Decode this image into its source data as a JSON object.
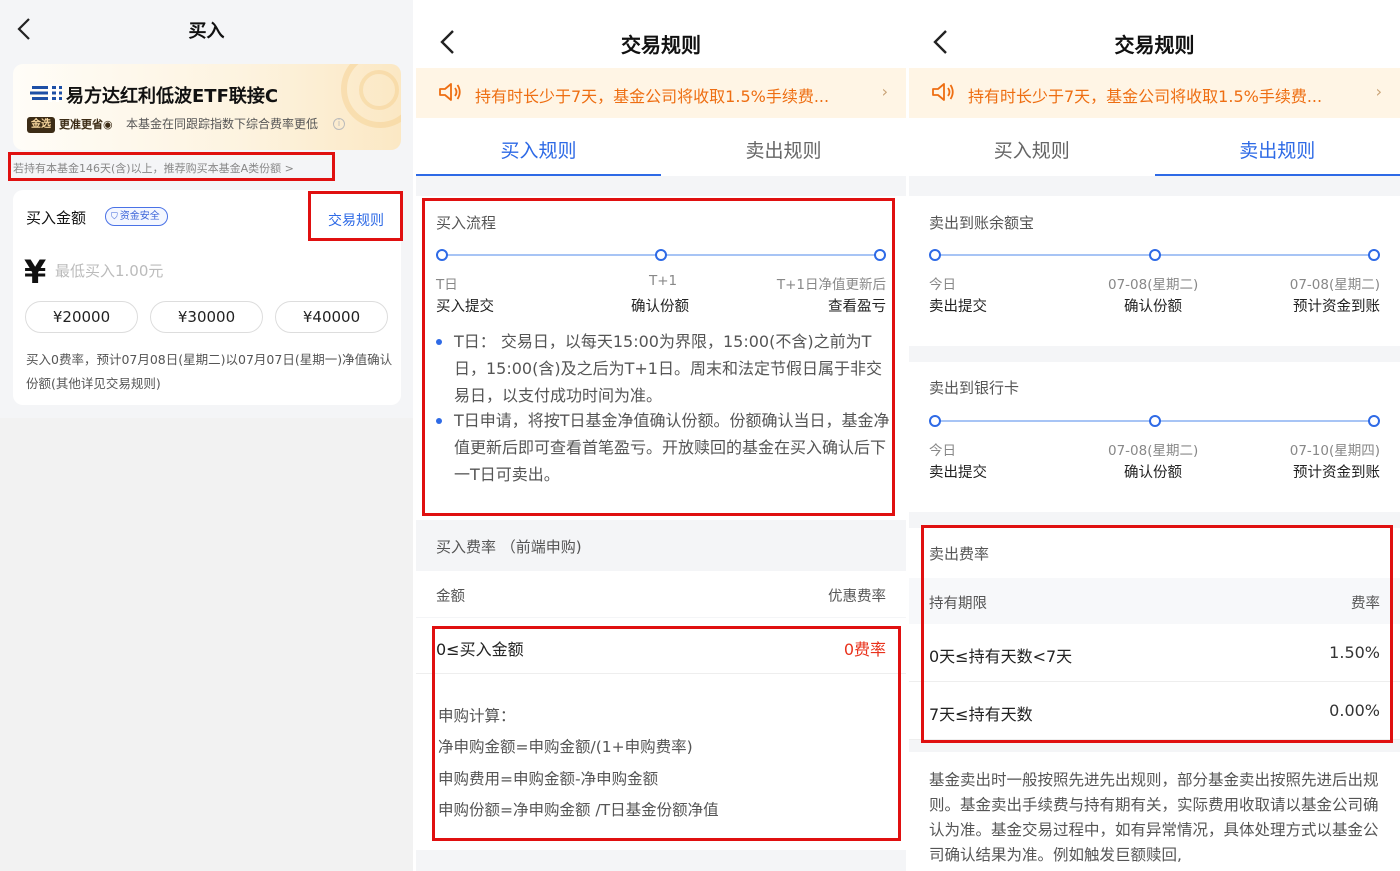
{
  "buy_page": {
    "title": "买入",
    "fund_name": "易方达红利低波ETF联接C",
    "badge_gold": "金选",
    "badge_text": "更准更省",
    "fund_note": "本基金在同跟踪指数下综合费率更低",
    "hold_tip": "若持有本基金146天(含)以上，推荐购买本基金A类份额",
    "amount_label": "买入金额",
    "safe_badge": "资金安全",
    "rule_link": "交易规则",
    "currency": "¥",
    "amount_placeholder": "最低买入1.00元",
    "quick_amounts": [
      "¥20000",
      "¥30000",
      "¥40000"
    ],
    "confirm_desc": "买入0费率，预计07月08日(星期二)以07月07日(星期一)净值确认份额(其他详见交易规则)"
  },
  "buy_rules": {
    "title": "交易规则",
    "notice": "持有时长少于7天，基金公司将收取1.5%手续费...",
    "tabs": [
      {
        "label": "买入规则"
      },
      {
        "label": "卖出规则"
      }
    ],
    "process": {
      "title": "买入流程",
      "steps": [
        {
          "day": "T日",
          "label": "买入提交"
        },
        {
          "day": "T+1",
          "label": "确认份额"
        },
        {
          "day": "T+1日净值更新后",
          "label": "查看盈亏"
        }
      ],
      "bullets": [
        "T日： 交易日，以每天15:00为界限，15:00(不含)之前为T日，15:00(含)及之后为T+1日。周末和法定节假日属于非交易日，以支付成功时间为准。",
        "T日申请，将按T日基金净值确认份额。份额确认当日，基金净值更新后即可查看首笔盈亏。开放赎回的基金在买入确认后下一T日可卖出。"
      ]
    },
    "fee": {
      "title": "买入费率 （前端申购)",
      "col_left": "金额",
      "col_right": "优惠费率",
      "row_left": "0≤买入金额",
      "row_right": "0费率",
      "calc_title": "申购计算：",
      "calc_lines": [
        "净申购金额=申购金额/(1+申购费率)",
        "申购费用=申购金额-净申购金额",
        "申购份额=净申购金额 /T日基金份额净值"
      ]
    }
  },
  "sell_rules": {
    "title": "交易规则",
    "notice": "持有时长少于7天，基金公司将收取1.5%手续费...",
    "tabs": [
      {
        "label": "买入规则"
      },
      {
        "label": "卖出规则"
      }
    ],
    "to_yuebao": {
      "title": "卖出到账余额宝",
      "steps": [
        {
          "day": "今日",
          "label": "卖出提交"
        },
        {
          "day": "07-08(星期二)",
          "label": "确认份额"
        },
        {
          "day": "07-08(星期二)",
          "label": "预计资金到账"
        }
      ]
    },
    "to_bank": {
      "title": "卖出到银行卡",
      "steps": [
        {
          "day": "今日",
          "label": "卖出提交"
        },
        {
          "day": "07-08(星期二)",
          "label": "确认份额"
        },
        {
          "day": "07-10(星期四)",
          "label": "预计资金到账"
        }
      ]
    },
    "fee": {
      "title": "卖出费率",
      "col_left": "持有期限",
      "col_right": "费率",
      "rows": [
        {
          "period": "0天≤持有天数<7天",
          "rate": "1.50%"
        },
        {
          "period": "7天≤持有天数",
          "rate": "0.00%"
        }
      ]
    },
    "footer_text": "基金卖出时一般按照先进先出规则，部分基金卖出按照先进后出规则。基金卖出手续费与持有期有关，实际费用收取请以基金公司确认为准。基金交易过程中，如有异常情况，具体处理方式以基金公司确认结果为准。例如触发巨额赎回,"
  },
  "colors": {
    "accent": "#2e6ae6",
    "notice_text": "#ee6e12",
    "highlight": "#e01010",
    "fee_red": "#e9321c"
  }
}
